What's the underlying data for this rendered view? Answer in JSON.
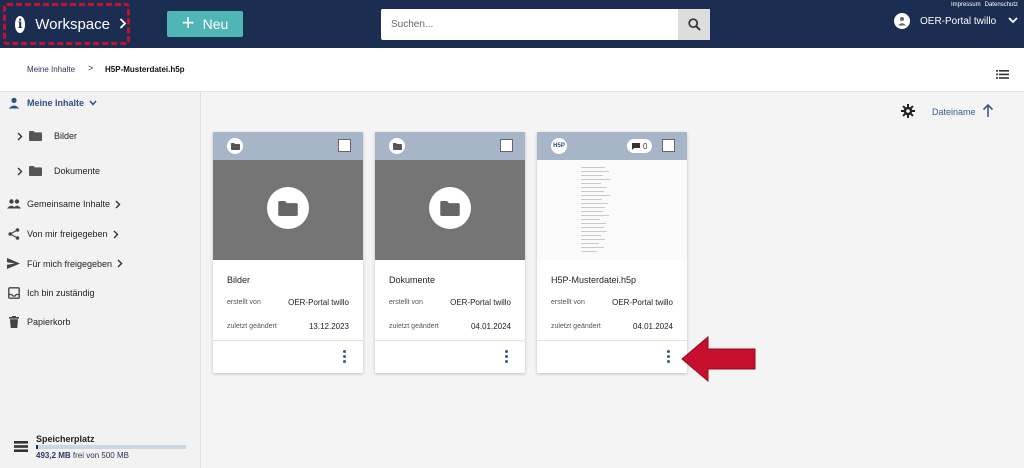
{
  "header": {
    "workspace_label": "Workspace",
    "new_label": "Neu",
    "search_placeholder": "Suchen...",
    "links": [
      "Impressum",
      "Datenschutz"
    ],
    "user_name": "OER-Portal twillo"
  },
  "breadcrumb": {
    "root": "Meine Inhalte",
    "separator": ">",
    "current": "H5P-Musterdatei.h5p"
  },
  "sidebar": {
    "my_content": "Meine Inhalte",
    "folders": [
      "Bilder",
      "Dokumente"
    ],
    "items": [
      {
        "label": "Gemeinsame Inhalte",
        "icon": "group-icon",
        "expandable": true
      },
      {
        "label": "Von mir freigegeben",
        "icon": "share-icon",
        "expandable": true
      },
      {
        "label": "Für mich freigegeben",
        "icon": "send-icon",
        "expandable": true
      },
      {
        "label": "Ich bin zuständig",
        "icon": "inbox-icon",
        "expandable": false
      },
      {
        "label": "Papierkorb",
        "icon": "trash-icon",
        "expandable": false
      }
    ],
    "storage": {
      "title": "Speicherplatz",
      "used": "493,2 MB",
      "rest": "frei von 500 MB",
      "used_fraction": 0.014
    }
  },
  "sort": {
    "label": "Dateiname"
  },
  "cards": [
    {
      "title": "Bilder",
      "created_label": "erstellt von",
      "created_by": "OER-Portal twillo",
      "modified_label": "zuletzt geändert",
      "modified": "13.12.2023",
      "type": "folder"
    },
    {
      "title": "Dokumente",
      "created_label": "erstellt von",
      "created_by": "OER-Portal twillo",
      "modified_label": "zuletzt geändert",
      "modified": "04.01.2024",
      "type": "folder"
    },
    {
      "title": "H5P-Musterdatei.h5p",
      "created_label": "erstellt von",
      "created_by": "OER-Portal twillo",
      "modified_label": "zuletzt geändert",
      "modified": "04.01.2024",
      "type": "h5p",
      "badge": "H5P",
      "comments": "0"
    }
  ],
  "colors": {
    "topbar": "#1c2d52",
    "accent": "#4fb5b5",
    "highlight": "#c8102e",
    "card_header": "#a6b5c7"
  }
}
